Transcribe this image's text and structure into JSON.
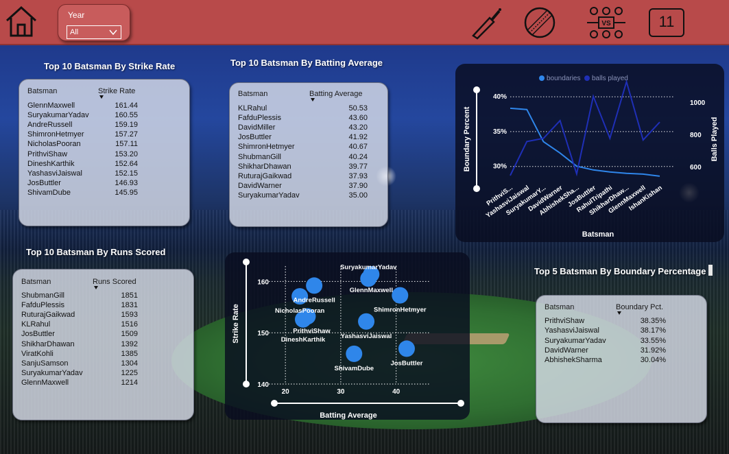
{
  "filters": {
    "year_label": "Year",
    "year_value": "All"
  },
  "nav_icons": [
    "home-icon",
    "cricket-bat-icon",
    "cricket-ball-icon",
    "team-vs-icon",
    "playing-eleven-icon"
  ],
  "nav_eleven_label": "11",
  "strike_rate_table": {
    "title": "Top 10 Batsman By Strike Rate",
    "col_name": "Batsman",
    "col_value": "Strike Rate",
    "rows": [
      {
        "name": "GlennMaxwell",
        "value": "161.44"
      },
      {
        "name": "SuryakumarYadav",
        "value": "160.55"
      },
      {
        "name": "AndreRussell",
        "value": "159.19"
      },
      {
        "name": "ShimronHetmyer",
        "value": "157.27"
      },
      {
        "name": "NicholasPooran",
        "value": "157.11"
      },
      {
        "name": "PrithviShaw",
        "value": "153.20"
      },
      {
        "name": "DineshKarthik",
        "value": "152.64"
      },
      {
        "name": "YashasviJaiswal",
        "value": "152.15"
      },
      {
        "name": "JosButtler",
        "value": "146.93"
      },
      {
        "name": "ShivamDube",
        "value": "145.95"
      }
    ]
  },
  "batting_avg_table": {
    "title": "Top 10 Batsman By Batting Average",
    "col_name": "Batsman",
    "col_value": "Batting Average",
    "rows": [
      {
        "name": "KLRahul",
        "value": "50.53"
      },
      {
        "name": "FafduPlessis",
        "value": "43.60"
      },
      {
        "name": "DavidMiller",
        "value": "43.20"
      },
      {
        "name": "JosButtler",
        "value": "41.92"
      },
      {
        "name": "ShimronHetmyer",
        "value": "40.67"
      },
      {
        "name": "ShubmanGill",
        "value": "40.24"
      },
      {
        "name": "ShikharDhawan",
        "value": "39.77"
      },
      {
        "name": "RuturajGaikwad",
        "value": "37.93"
      },
      {
        "name": "DavidWarner",
        "value": "37.90"
      },
      {
        "name": "SuryakumarYadav",
        "value": "35.00"
      }
    ]
  },
  "runs_table": {
    "title": "Top 10 Batsman By Runs Scored",
    "col_name": "Batsman",
    "col_value": "Runs Scored",
    "rows": [
      {
        "name": "ShubmanGill",
        "value": "1851"
      },
      {
        "name": "FafduPlessis",
        "value": "1831"
      },
      {
        "name": "RuturajGaikwad",
        "value": "1593"
      },
      {
        "name": "KLRahul",
        "value": "1516"
      },
      {
        "name": "JosButtler",
        "value": "1509"
      },
      {
        "name": "ShikharDhawan",
        "value": "1392"
      },
      {
        "name": "ViratKohli",
        "value": "1385"
      },
      {
        "name": "SanjuSamson",
        "value": "1304"
      },
      {
        "name": "SuryakumarYadav",
        "value": "1225"
      },
      {
        "name": "GlennMaxwell",
        "value": "1214"
      }
    ]
  },
  "boundary_table": {
    "title": "Top 5 Batsman By Boundary Percentage",
    "col_name": "Batsman",
    "col_value": "Boundary Pct.",
    "rows": [
      {
        "name": "PrithviShaw",
        "value": "38.35%"
      },
      {
        "name": "YashasviJaiswal",
        "value": "38.17%"
      },
      {
        "name": "SuryakumarYadav",
        "value": "33.55%"
      },
      {
        "name": "DavidWarner",
        "value": "31.92%"
      },
      {
        "name": "AbhishekSharma",
        "value": "30.04%"
      }
    ]
  },
  "chart_data": [
    {
      "type": "line",
      "title": "",
      "legend": [
        "boundaries",
        "balls played"
      ],
      "legend_position": "top",
      "xlabel": "Batsman",
      "ylabel_left": "Boundary Percent",
      "ylabel_right": "Balls Played",
      "categories": [
        "PrithviS...",
        "YashasviJaiswal",
        "SuryakumarY...",
        "DavidWarner",
        "AbhishekSha...",
        "JosButtler",
        "RahulTripathi",
        "ShikharDhaw...",
        "GlennMaxwell",
        "IshanKishan"
      ],
      "series": [
        {
          "name": "boundaries",
          "axis": "left",
          "color": "#2f86ea",
          "values": [
            38.35,
            38.17,
            33.55,
            31.92,
            30.04,
            29.5,
            29.2,
            29.0,
            28.9,
            28.6
          ]
        },
        {
          "name": "balls played",
          "axis": "right",
          "color": "#1f2fb6",
          "values": [
            550,
            760,
            780,
            890,
            560,
            1040,
            780,
            1130,
            770,
            880
          ]
        }
      ],
      "y_left_ticks": [
        "30%",
        "35%",
        "40%"
      ],
      "y_left_range": [
        28,
        41
      ],
      "y_right_ticks": [
        "600",
        "800",
        "1000"
      ],
      "y_right_range": [
        520,
        1080
      ],
      "grid": true
    },
    {
      "type": "scatter",
      "title": "",
      "xlabel": "Batting Average",
      "ylabel": "Strike Rate",
      "xlim": [
        18,
        45
      ],
      "ylim": [
        140,
        163
      ],
      "x_ticks": [
        "20",
        "30",
        "40"
      ],
      "y_ticks": [
        "140",
        "150",
        "160"
      ],
      "grid": true,
      "color": "#2f86ea",
      "points": [
        {
          "label": "SuryakumarYadav",
          "x": 35.0,
          "y": 160.55
        },
        {
          "label": "GlennMaxwell",
          "x": 35.5,
          "y": 161.4
        },
        {
          "label": "AndreRussell",
          "x": 25.2,
          "y": 159.2
        },
        {
          "label": "NicholasPooran",
          "x": 22.6,
          "y": 157.1
        },
        {
          "label": "ShimronHetmyer",
          "x": 40.7,
          "y": 157.3
        },
        {
          "label": "PrithviShaw",
          "x": 24.0,
          "y": 153.2
        },
        {
          "label": "DineshKarthik",
          "x": 23.2,
          "y": 152.6
        },
        {
          "label": "YashasviJaiswal",
          "x": 34.6,
          "y": 152.2
        },
        {
          "label": "JosButtler",
          "x": 41.9,
          "y": 146.9
        },
        {
          "label": "ShivamDube",
          "x": 32.4,
          "y": 145.9
        }
      ]
    }
  ]
}
